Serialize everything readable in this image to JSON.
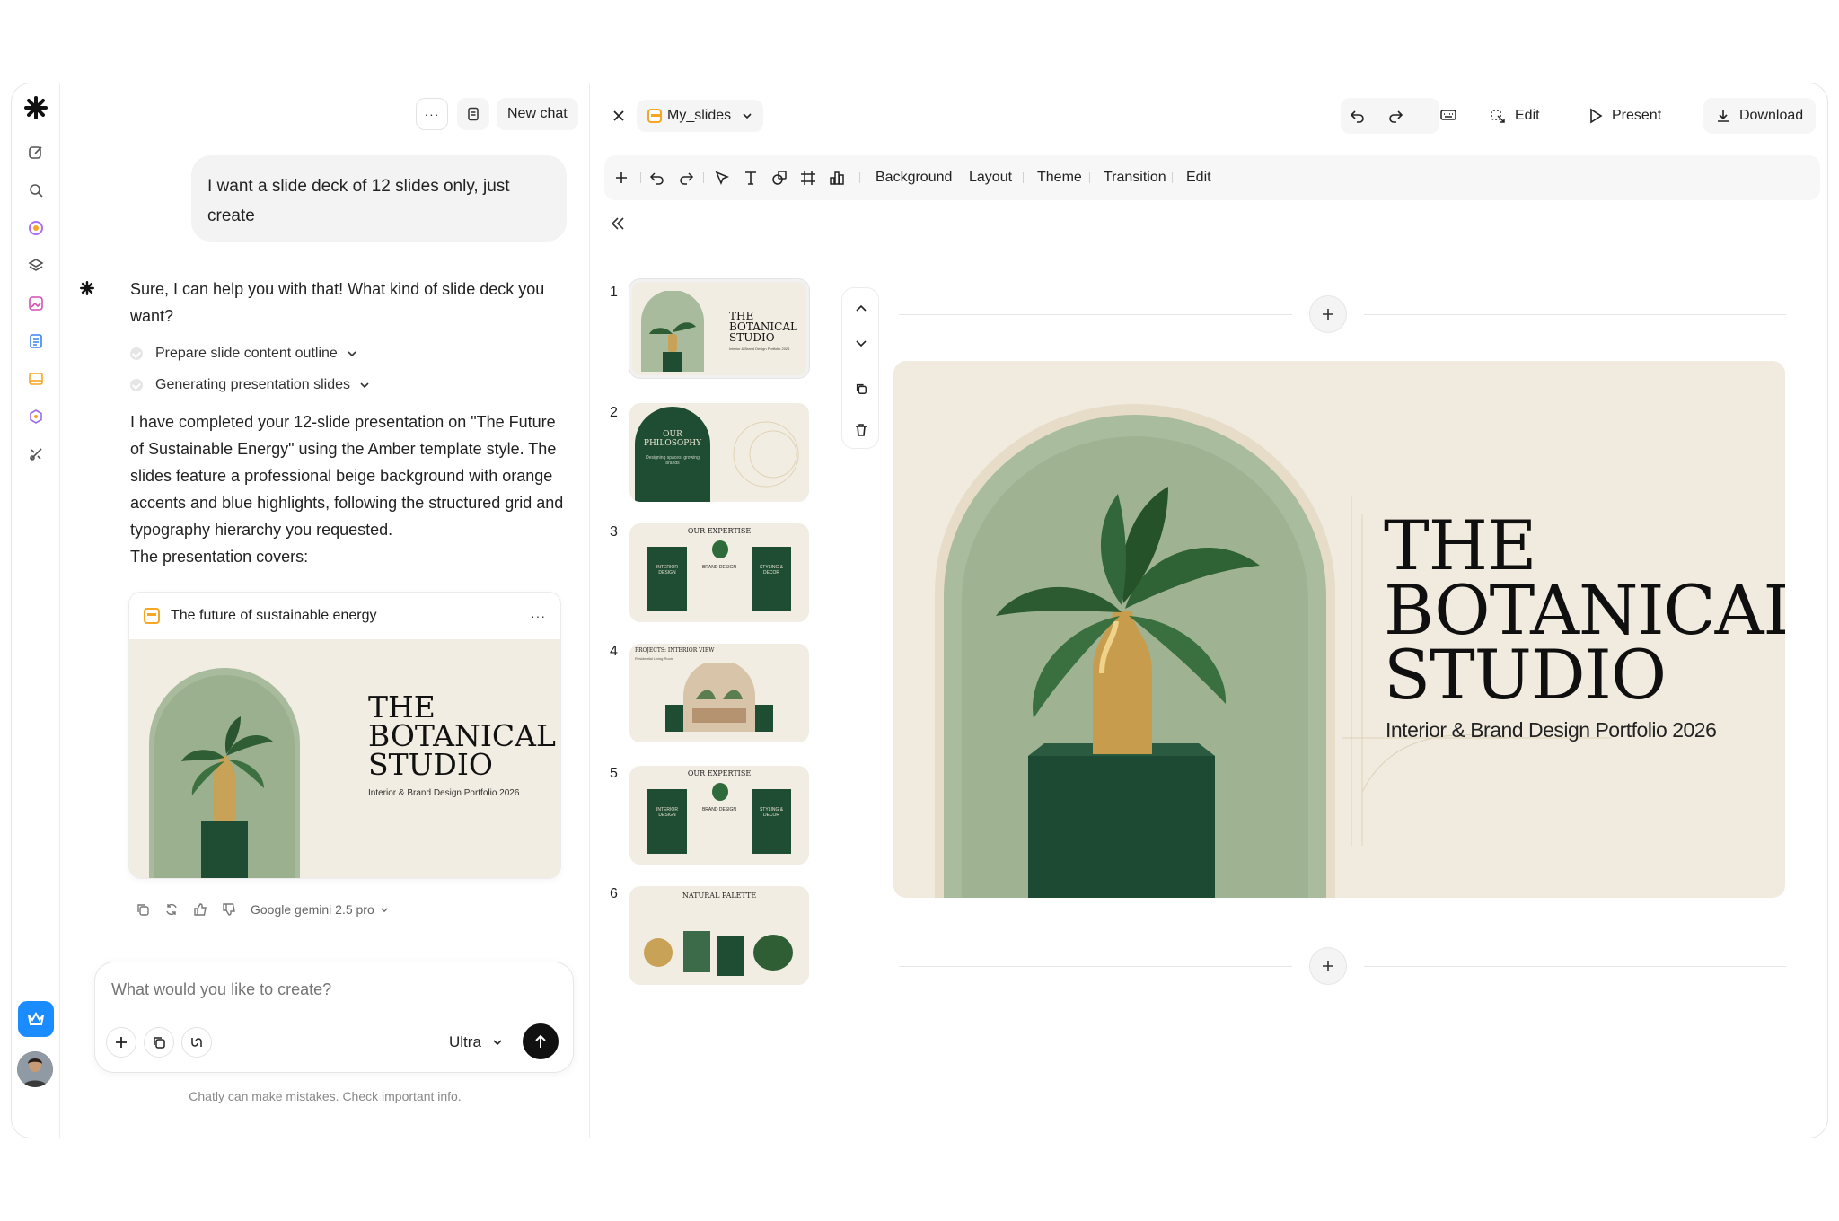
{
  "chat": {
    "more_label": "···",
    "new_chat_label": "New chat",
    "user_message": "I want a slide deck of 12 slides only, just create",
    "assistant_intro": "Sure, I can help you with that! What kind of slide deck you want?",
    "steps": [
      {
        "label": "Prepare slide content outline"
      },
      {
        "label": "Generating presentation slides"
      }
    ],
    "assistant_summary": "I have completed your 12-slide presentation on \"The Future of Sustainable Energy\" using the Amber template style. The slides feature a professional beige background with orange accents and blue highlights, following the structured grid and typography hierarchy you requested.",
    "covers_label": "The presentation covers:",
    "card": {
      "title": "The future of sustainable energy",
      "more": "···",
      "slide_title_lines": [
        "THE",
        "BOTANICAL",
        "STUDIO"
      ],
      "slide_subtitle": "Interior & Brand Design Portfolio 2026"
    },
    "model_label": "Google gemini 2.5 pro",
    "composer": {
      "placeholder": "What would you like to create?",
      "mode_label": "Ultra"
    },
    "disclaimer": "Chatly can make mistakes. Check important info."
  },
  "editor": {
    "file_name": "My_slides",
    "top_actions": {
      "edit": "Edit",
      "present": "Present",
      "download": "Download"
    },
    "toolbar_items": [
      "Background",
      "Layout",
      "Theme",
      "Transition",
      "Edit"
    ],
    "thumbnails": [
      {
        "num": "1",
        "title_lines": [
          "THE",
          "BOTANICAL",
          "STUDIO"
        ],
        "subtitle": "Interior & Brand Design Portfolio 2026"
      },
      {
        "num": "2",
        "title_lines": [
          "OUR",
          "PHILOSOPHY"
        ],
        "subtitle": "Designing spaces, growing brands"
      },
      {
        "num": "3",
        "title": "OUR EXPERTISE",
        "cols": [
          "INTERIOR DESIGN",
          "BRAND DESIGN",
          "STYLING & DECOR"
        ]
      },
      {
        "num": "4",
        "title": "PROJECTS: INTERIOR VIEW",
        "subtitle": "Residential Living Room"
      },
      {
        "num": "5",
        "title": "OUR EXPERTISE",
        "cols": [
          "INTERIOR DESIGN",
          "BRAND DESIGN",
          "STYLING & DECOR"
        ]
      },
      {
        "num": "6",
        "title": "NATURAL PALETTE"
      }
    ],
    "main_slide": {
      "title_lines": [
        "THE",
        "BOTANICAL",
        "STUDIO"
      ],
      "subtitle": "Interior & Brand Design Portfolio 2026"
    }
  },
  "colors": {
    "accent_green": "#1e4d34",
    "beige": "#f1ebdf",
    "amber": "#f5a623",
    "premium_blue": "#1a8cff"
  }
}
